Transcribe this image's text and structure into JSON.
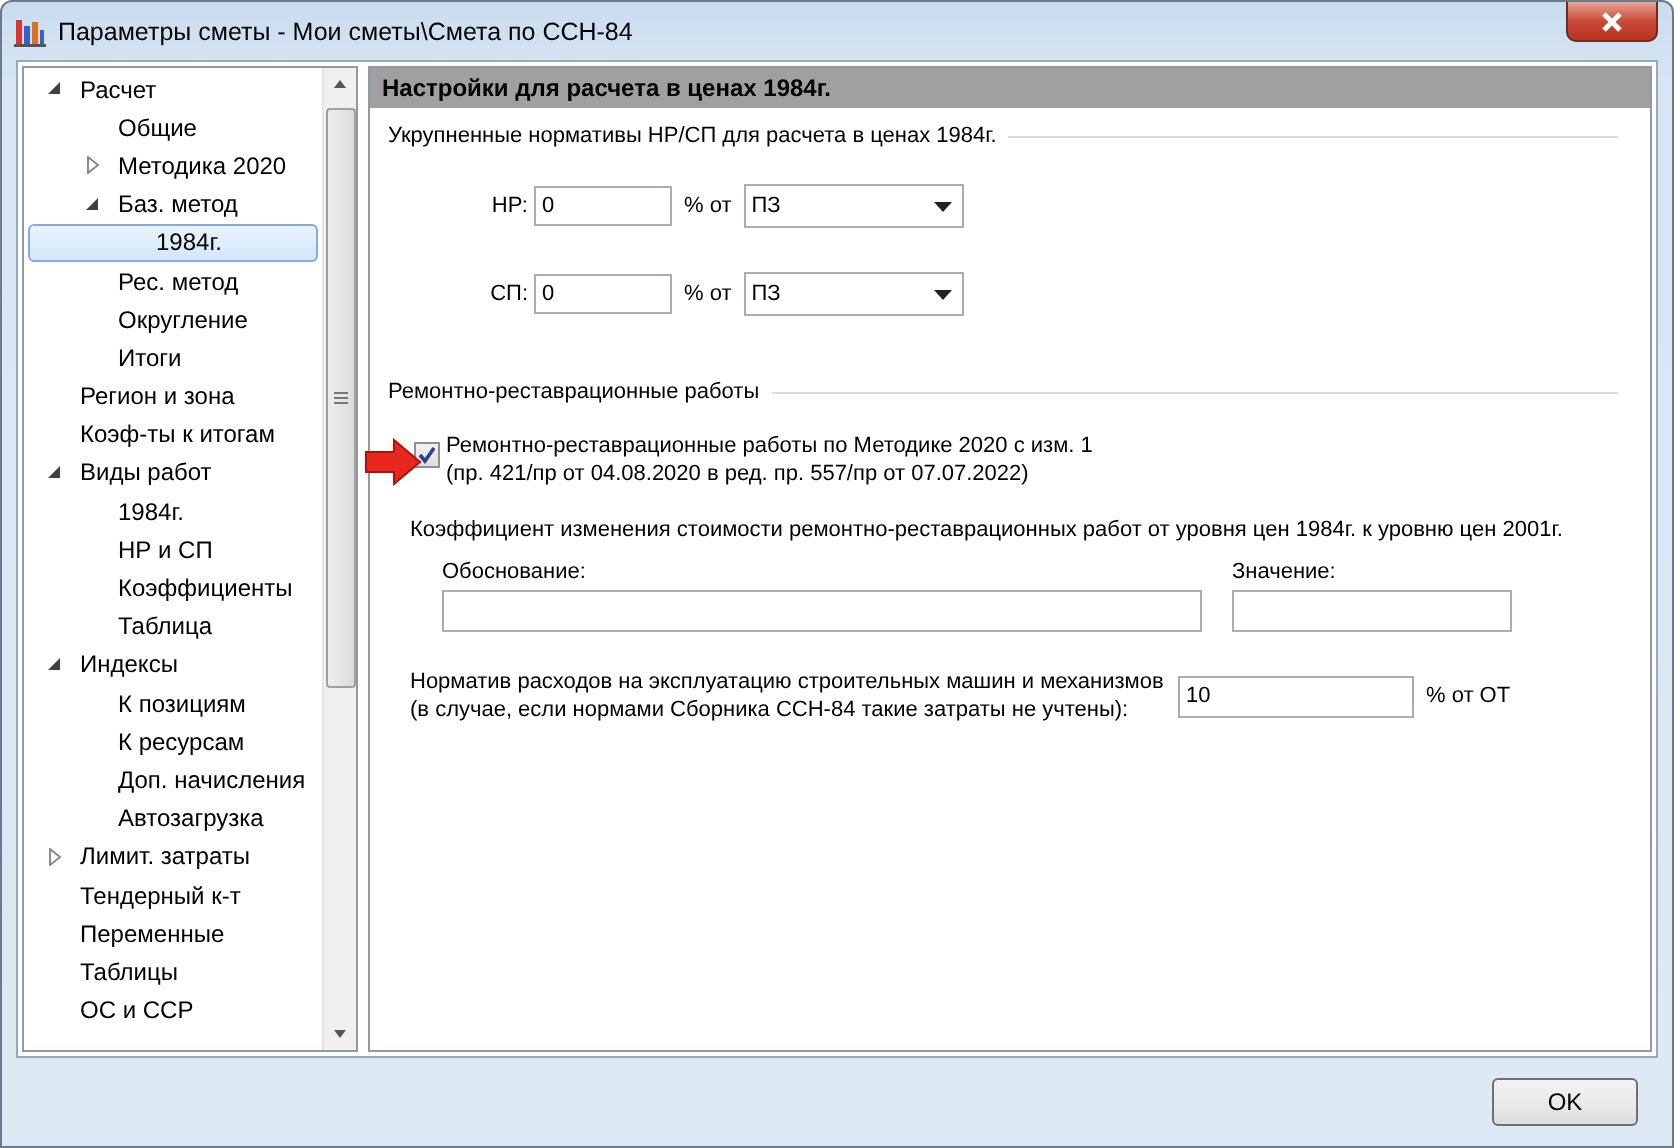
{
  "window": {
    "title": "Параметры сметы - Мои сметы\\Смета по ССН-84"
  },
  "tree": [
    {
      "label": "Расчет",
      "expanded": true,
      "selected": false,
      "children": [
        {
          "label": "Общие",
          "selected": false
        },
        {
          "label": "Методика 2020",
          "expanded": false,
          "selected": false
        },
        {
          "label": "Баз. метод",
          "expanded": true,
          "selected": false,
          "children": [
            {
              "label": "1984г.",
              "selected": true
            }
          ]
        },
        {
          "label": "Рес. метод",
          "selected": false
        },
        {
          "label": "Округление",
          "selected": false
        },
        {
          "label": "Итоги",
          "selected": false
        }
      ]
    },
    {
      "label": "Регион и зона",
      "selected": false
    },
    {
      "label": "Коэф-ты к итогам",
      "selected": false
    },
    {
      "label": "Виды работ",
      "expanded": true,
      "selected": false,
      "children": [
        {
          "label": "1984г.",
          "selected": false
        },
        {
          "label": "НР и СП",
          "selected": false
        },
        {
          "label": "Коэффициенты",
          "selected": false
        },
        {
          "label": "Таблица",
          "selected": false
        }
      ]
    },
    {
      "label": "Индексы",
      "expanded": true,
      "selected": false,
      "children": [
        {
          "label": "К позициям",
          "selected": false
        },
        {
          "label": "К ресурсам",
          "selected": false
        },
        {
          "label": "Доп. начисления",
          "selected": false
        },
        {
          "label": "Автозагрузка",
          "selected": false
        }
      ]
    },
    {
      "label": "Лимит. затраты",
      "expanded": false,
      "selected": false
    },
    {
      "label": "Тендерный к-т",
      "selected": false
    },
    {
      "label": "Переменные",
      "selected": false
    },
    {
      "label": "Таблицы",
      "selected": false
    },
    {
      "label": "ОС и ССР",
      "selected": false
    }
  ],
  "panel": {
    "title": "Настройки для расчета в ценах 1984г."
  },
  "overhead": {
    "legend": "Укрупненные нормативы НР/СП для расчета в ценах 1984г.",
    "rows": [
      {
        "label": "НР:",
        "value": "0",
        "unit": "% от",
        "base": "ПЗ"
      },
      {
        "label": "СП:",
        "value": "0",
        "unit": "% от",
        "base": "ПЗ"
      }
    ]
  },
  "restoration": {
    "legend": "Ремонтно-реставрационные работы",
    "checkbox": {
      "label": "Ремонтно-реставрационные работы по Методике 2020 с изм. 1\n(пр. 421/пр от 04.08.2020 в ред. пр. 557/пр от 07.07.2022)",
      "checked": true
    },
    "coefficient": {
      "caption": "Коэффициент изменения стоимости ремонтно-реставрационных работ от уровня цен 1984г. к уровню цен 2001г.",
      "fields": [
        {
          "label": "Обоснование:"
        },
        {
          "label": "Значение:"
        }
      ]
    },
    "machines": {
      "label": "Норматив расходов на эксплуатацию строительных машин и механизмов\n(в случае, если нормами Сборника ССН-84 такие затраты не учтены):",
      "value": "10",
      "unit": "% от ОТ"
    }
  },
  "buttons": [
    "OK"
  ]
}
